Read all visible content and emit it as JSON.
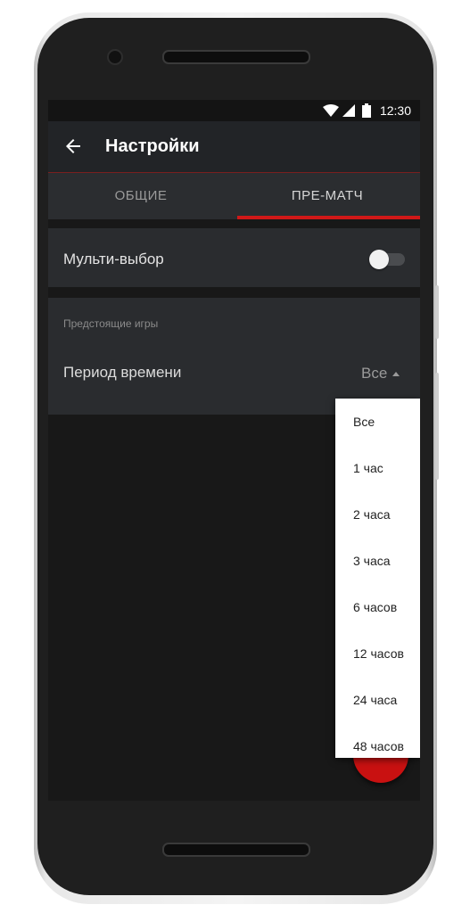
{
  "status_bar": {
    "time": "12:30"
  },
  "app_bar": {
    "title": "Настройки"
  },
  "tabs": [
    {
      "label": "ОБЩИЕ",
      "active": false
    },
    {
      "label": "ПРЕ-МАТЧ",
      "active": true
    }
  ],
  "multi_select": {
    "label": "Мульти-выбор",
    "enabled": false
  },
  "upcoming": {
    "section_title": "Предстоящие игры",
    "period_label": "Период времени",
    "period_value": "Все"
  },
  "dropdown_options": [
    "Все",
    "1 час",
    "2 часа",
    "3 часа",
    "6 часов",
    "12 часов",
    "24 часа",
    "48 часов"
  ],
  "colors": {
    "accent": "#d01818",
    "appbar": "#222427",
    "card": "#2a2c2f",
    "background": "#181818"
  }
}
